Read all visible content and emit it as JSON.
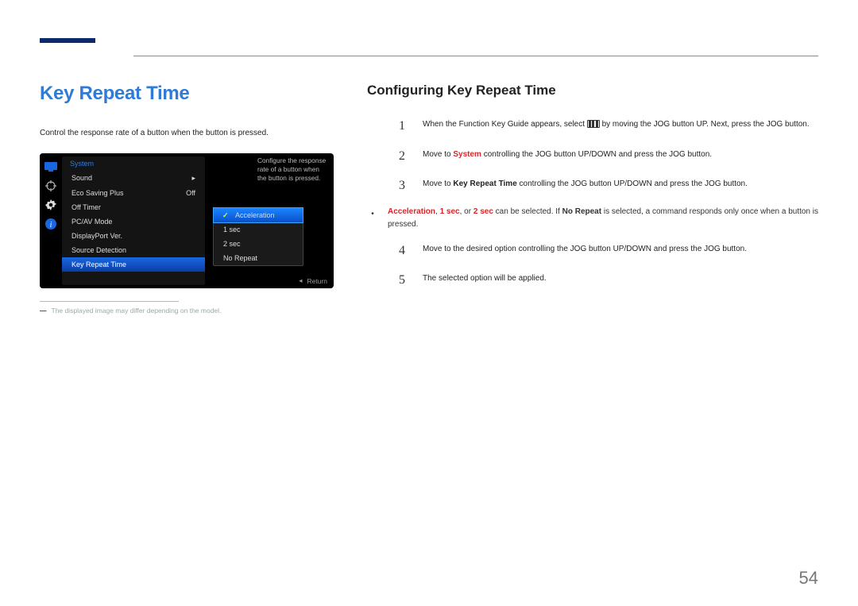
{
  "header": {
    "title": "Key Repeat Time",
    "right_title": "Configuring Key Repeat Time"
  },
  "left": {
    "lead": "Control the response rate of a button when the button is pressed.",
    "osd": {
      "section": "System",
      "items": [
        {
          "label": "Sound",
          "value": "▸"
        },
        {
          "label": "Eco Saving Plus",
          "value": "Off"
        },
        {
          "label": "Off Timer",
          "value": ""
        },
        {
          "label": "PC/AV Mode",
          "value": ""
        },
        {
          "label": "DisplayPort Ver.",
          "value": ""
        },
        {
          "label": "Source Detection",
          "value": ""
        },
        {
          "label": "Key Repeat Time",
          "value": "",
          "selected": true
        }
      ],
      "popup": [
        {
          "label": "Acceleration",
          "selected": true
        },
        {
          "label": "1 sec"
        },
        {
          "label": "2 sec"
        },
        {
          "label": "No Repeat"
        }
      ],
      "tooltip": "Configure the response rate of a button when the button is pressed.",
      "footer_label": "Return"
    },
    "footnote": "The displayed image may differ depending on the model."
  },
  "right": {
    "steps": {
      "1": {
        "pre": "When the Function Key Guide appears, select ",
        "post": " by moving the JOG button UP. Next, press the JOG button."
      },
      "2": {
        "pre": "Move to ",
        "hl": "System",
        "post": " controlling the JOG button UP/DOWN and press the JOG button."
      },
      "3": {
        "pre": "Move to ",
        "hl": "Key Repeat Time",
        "post": " controlling the JOG button UP/DOWN and press the JOG button."
      },
      "4": "Move to the desired option controlling the JOG button UP/DOWN and press the JOG button.",
      "5": "The selected option will be applied."
    },
    "note": {
      "t1": "Acceleration",
      "t2": "1 sec",
      "t3": "2 sec",
      "mid1": ", ",
      "mid2": ", or ",
      "mid3": " can be selected. If ",
      "t4": "No Repeat",
      "post": " is selected, a command responds only once when a button is pressed."
    }
  },
  "page_number": "54"
}
